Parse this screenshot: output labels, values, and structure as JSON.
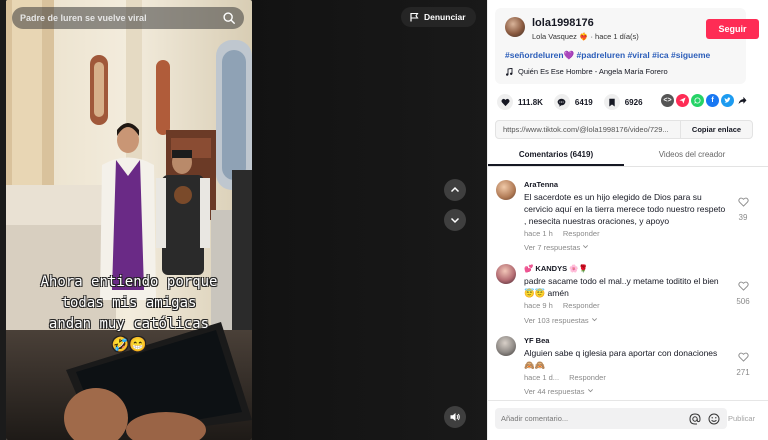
{
  "search": {
    "placeholder": "Padre de luren se vuelve viral"
  },
  "video": {
    "report_label": "Denunciar",
    "caption_lines": [
      "Ahora entiendo porque",
      "todas mis amigas",
      "andan muy católicas"
    ],
    "caption_emoji": "🤣😁"
  },
  "author": {
    "username": "lola1998176",
    "display_name": "Lola Vasquez",
    "name_emoji": "❤️‍🔥",
    "posted": "hace 1 día(s)",
    "follow_label": "Seguir"
  },
  "post": {
    "hashtags": "#señordeluren💜 #padreluren #viral #ica #sigueme",
    "music": "Quién Es Ese Hombre - Angela María Forero"
  },
  "stats": {
    "likes": "111.8K",
    "comments": "6419",
    "saves": "6926"
  },
  "share_icons": [
    "embed-icon",
    "send-icon",
    "whatsapp-icon",
    "facebook-icon",
    "twitter-icon",
    "share-arrow-icon"
  ],
  "link": {
    "url": "https://www.tiktok.com/@lola1998176/video/729...",
    "copy_label": "Copiar enlace"
  },
  "tabs": [
    {
      "label": "Comentarios (6419)",
      "active": true
    },
    {
      "label": "Videos del creador",
      "active": false
    }
  ],
  "comments": [
    {
      "user": "AraTenna",
      "text": "El sacerdote es un hijo elegido de Dios para su cervicio aquí en la tierra merece todo nuestro respeto , nesecita nuestras oraciones, y apoyo",
      "time": "hace 1 h",
      "reply": "Responder",
      "replies": "Ver 7 respuestas",
      "likes": "39"
    },
    {
      "user": "💕 KANDYS 🌸🌹",
      "text": "padre sacame todo el mal..y metame toditito el bien 😇😇 amén",
      "time": "hace 9 h",
      "reply": "Responder",
      "replies": "Ver 103 respuestas",
      "likes": "506"
    },
    {
      "user": "YF Bea",
      "text": "Alguien sabe q iglesia para aportar con donaciones 🙈🙈",
      "time": "hace 1 d...",
      "reply": "Responder",
      "replies": "Ver 44 respuestas",
      "likes": "271"
    }
  ],
  "composer": {
    "placeholder": "Añadir comentario...",
    "publish_label": "Publicar"
  }
}
